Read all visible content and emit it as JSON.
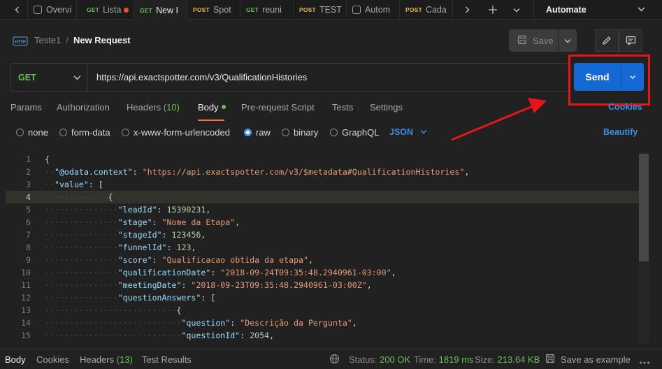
{
  "tabs": [
    {
      "method": "",
      "label": "Overvi",
      "kind": "overview"
    },
    {
      "method": "GET",
      "label": "Lista",
      "dot": true
    },
    {
      "method": "GET",
      "label": "New I",
      "active": true
    },
    {
      "method": "POST",
      "label": "Spot"
    },
    {
      "method": "GET",
      "label": "reuni"
    },
    {
      "method": "POST",
      "label": "TEST"
    },
    {
      "method": "",
      "label": "Autom",
      "kind": "automation"
    },
    {
      "method": "POST",
      "label": "Cada"
    }
  ],
  "environment": {
    "label": "Automate"
  },
  "header": {
    "collection": "Teste1",
    "separator": "/",
    "request_name": "New Request",
    "save_label": "Save"
  },
  "request": {
    "method": "GET",
    "url": "https://api.exactspotter.com/v3/QualificationHistories",
    "send_label": "Send"
  },
  "request_tabs": {
    "params": "Params",
    "authorization": "Authorization",
    "headers": "Headers",
    "headers_count": "(10)",
    "body": "Body",
    "prerequest": "Pre-request Script",
    "tests": "Tests",
    "settings": "Settings",
    "cookies": "Cookies"
  },
  "body_options": {
    "none": "none",
    "form_data": "form-data",
    "urlencoded": "x-www-form-urlencoded",
    "raw": "raw",
    "binary": "binary",
    "graphql": "GraphQL",
    "format": "JSON",
    "beautify": "Beautify",
    "selected": "raw"
  },
  "editor_lines": [
    "1",
    "2",
    "3",
    "4",
    "5",
    "6",
    "7",
    "8",
    "9",
    "10",
    "11",
    "12",
    "13",
    "14",
    "15"
  ],
  "code": {
    "odata_key": "\"@odata.context\"",
    "odata_val": "\"https://api.exactspotter.com/v3/$metadata#QualificationHistories\"",
    "value_key": "\"value\"",
    "leadId_key": "\"leadId\"",
    "leadId_val": "15390231",
    "stage_key": "\"stage\"",
    "stage_val": "\"Nome da Etapa\"",
    "stageId_key": "\"stageId\"",
    "stageId_val": "123456",
    "funnelId_key": "\"funnelId\"",
    "funnelId_val": "123",
    "score_key": "\"score\"",
    "score_val": "\"Qualificacao obtida da etapa\"",
    "qualificationDate_key": "\"qualificationDate\"",
    "qualificationDate_val": "\"2018-09-24T09:35:48.2940961-03:00\"",
    "meetingDate_key": "\"meetingDate\"",
    "meetingDate_val": "\"2018-09-23T09:35:48.2940961-03:00Z\"",
    "questionAnswers_key": "\"questionAnswers\"",
    "question_key": "\"question\"",
    "question_val": "\"Descrição da Pergunta\"",
    "questionId_key": "\"questionId\"",
    "questionId_val": "2054"
  },
  "response_bar": {
    "body": "Body",
    "cookies": "Cookies",
    "headers": "Headers",
    "headers_count": "(13)",
    "test_results": "Test Results",
    "status_label": "Status:",
    "status_value": "200 OK",
    "time_label": "Time:",
    "time_value": "1819 ms",
    "size_label": "Size:",
    "size_value": "213.64 KB",
    "save_example": "Save as example"
  },
  "colors": {
    "send": "#1469d4",
    "get": "#6bbf59",
    "post": "#e5b84c",
    "accent_link": "#3b8fe8",
    "annotation": "#e8141a",
    "active_underline": "#ff6c37"
  }
}
